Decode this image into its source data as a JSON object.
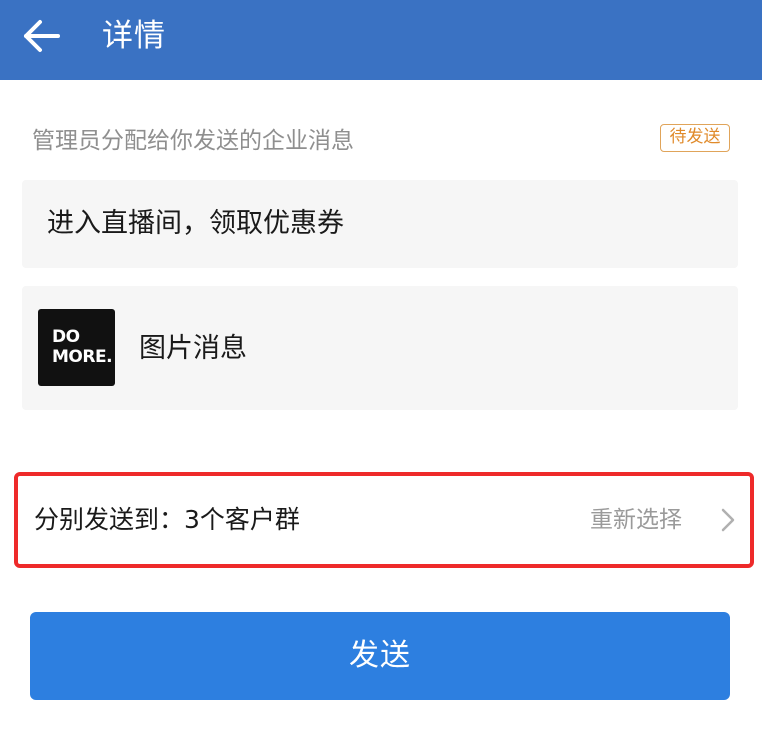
{
  "header": {
    "title": "详情",
    "back_icon": "arrow-left-icon"
  },
  "intro": {
    "text": "管理员分配给你发送的企业消息",
    "status_badge": "待发送"
  },
  "messages": {
    "text_message": "进入直播间，领取优惠券",
    "image_message": {
      "thumbnail_line1": "DO",
      "thumbnail_line2": "MORE.",
      "label": "图片消息"
    }
  },
  "target": {
    "label": "分别发送到：3个客户群",
    "action": "重新选择",
    "action_icon": "chevron-right-icon"
  },
  "send_button": {
    "label": "发送"
  },
  "colors": {
    "header_bg": "#3a72c3",
    "badge": "#e08a2a",
    "highlight_border": "#ee2a2a",
    "primary_button": "#2d7fe0"
  }
}
